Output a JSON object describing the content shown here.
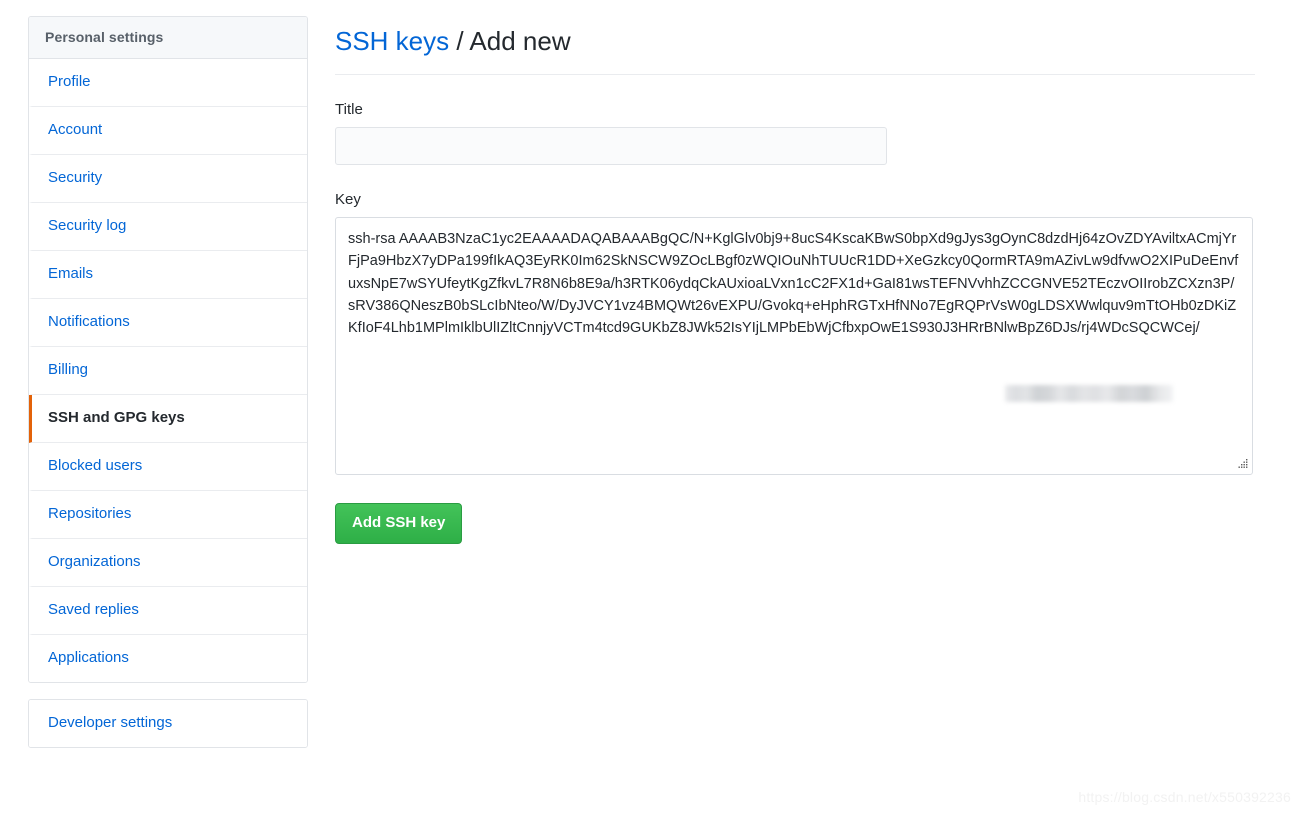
{
  "sidebar": {
    "header": "Personal settings",
    "groups": [
      {
        "items": [
          {
            "label": "Profile",
            "active": false
          },
          {
            "label": "Account",
            "active": false
          },
          {
            "label": "Security",
            "active": false
          },
          {
            "label": "Security log",
            "active": false
          },
          {
            "label": "Emails",
            "active": false
          },
          {
            "label": "Notifications",
            "active": false
          },
          {
            "label": "Billing",
            "active": false
          },
          {
            "label": "SSH and GPG keys",
            "active": true
          },
          {
            "label": "Blocked users",
            "active": false
          },
          {
            "label": "Repositories",
            "active": false
          },
          {
            "label": "Organizations",
            "active": false
          },
          {
            "label": "Saved replies",
            "active": false
          },
          {
            "label": "Applications",
            "active": false
          }
        ]
      },
      {
        "items": [
          {
            "label": "Developer settings",
            "active": false
          }
        ]
      }
    ]
  },
  "header": {
    "breadcrumb_link": "SSH keys",
    "breadcrumb_separator": "/",
    "breadcrumb_current": "Add new"
  },
  "form": {
    "title_label": "Title",
    "title_value": "",
    "title_placeholder": "",
    "key_label": "Key",
    "key_value": "ssh-rsa AAAAB3NzaC1yc2EAAAADAQABAAABgQC/N+KglGlv0bj9+8ucS4KscaKBwS0bpXd9gJys3gOynC8dzdHj64zOvZDYAviltxACmjYrFjPa9HbzX7yDPa199fIkAQ3EyRK0Im62SkNSCW9ZOcLBgf0zWQIOuNhTUUcR1DD+XeGzkcy0QormRTA9mAZivLw9dfvwO2XIPuDeEnvfuxsNpE7wSYUfeytKgZfkvL7R8N6b8E9a/h3RTK06ydqCkAUxioaLVxn1cC2FX1d+GaI81wsTEFNVvhhZCCGNVE52TEczvOIIrobZCXzn3P/sRV386QNeszB0bSLcIbNteo/W/DyJVCY1vz4BMQWt26vEXPU/Gvokq+eHphRGTxHfNNo7EgRQPrVsW0gLDSXWwlquv9mTtOHb0zDKiZKfIoF4Lhb1MPlmIklbUlIZltCnnjyVCTm4tcd9GUKbZ8JWk52IsYIjLMPbEbWjCfbxpOwE1S930J3HRrBNlwBpZ6DJs/rj4WDcSQCWCej/",
    "key_redacted_note": "redacted",
    "submit_label": "Add SSH key"
  },
  "watermark": {
    "text": "https://blog.csdn.net/x550392236"
  },
  "colors": {
    "link": "#0366d6",
    "active_accent": "#e36209",
    "submit_green": "#34ad4e",
    "border": "#e1e4e8",
    "text": "#24292e"
  }
}
